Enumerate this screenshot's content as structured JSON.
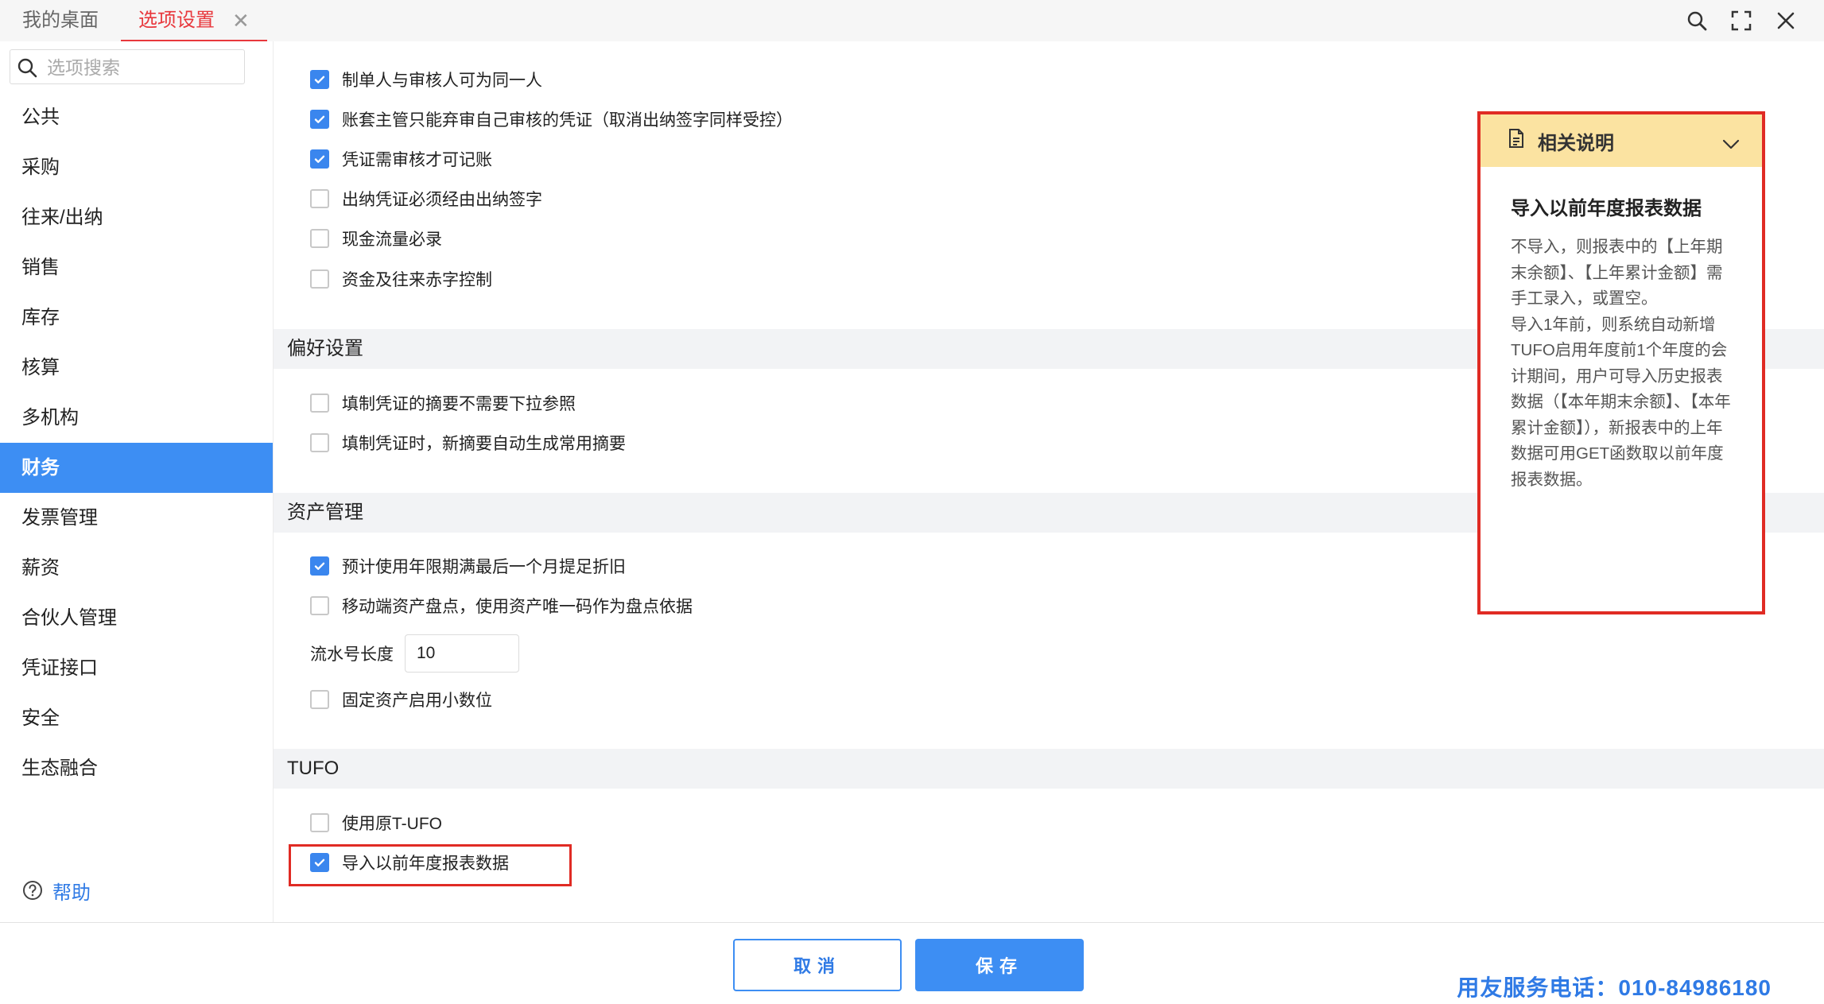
{
  "tabs": {
    "home": "我的桌面",
    "active": "选项设置",
    "close": "✕"
  },
  "toolbar_icons": [
    "search-icon",
    "fullscreen-icon",
    "close-icon"
  ],
  "search": {
    "placeholder": "选项搜索"
  },
  "nav": {
    "items": [
      {
        "label": "公共",
        "active": false
      },
      {
        "label": "采购",
        "active": false
      },
      {
        "label": "往来/出纳",
        "active": false
      },
      {
        "label": "销售",
        "active": false
      },
      {
        "label": "库存",
        "active": false
      },
      {
        "label": "核算",
        "active": false
      },
      {
        "label": "多机构",
        "active": false
      },
      {
        "label": "财务",
        "active": true
      },
      {
        "label": "发票管理",
        "active": false
      },
      {
        "label": "薪资",
        "active": false
      },
      {
        "label": "合伙人管理",
        "active": false
      },
      {
        "label": "凭证接口",
        "active": false
      },
      {
        "label": "安全",
        "active": false
      },
      {
        "label": "生态融合",
        "active": false
      }
    ],
    "help": "帮助"
  },
  "voucher_options": [
    {
      "label": "制单人与审核人可为同一人",
      "checked": true
    },
    {
      "label": "账套主管只能弃审自己审核的凭证（取消出纳签字同样受控）",
      "checked": true
    },
    {
      "label": "凭证需审核才可记账",
      "checked": true
    },
    {
      "label": "出纳凭证必须经由出纳签字",
      "checked": false
    },
    {
      "label": "现金流量必录",
      "checked": false
    },
    {
      "label": "资金及往来赤字控制",
      "checked": false
    }
  ],
  "preference": {
    "title": "偏好设置",
    "options": [
      {
        "label": "填制凭证的摘要不需要下拉参照",
        "checked": false
      },
      {
        "label": "填制凭证时，新摘要自动生成常用摘要",
        "checked": false
      }
    ]
  },
  "assets": {
    "title": "资产管理",
    "options": [
      {
        "label": "预计使用年限期满最后一个月提足折旧",
        "checked": true
      },
      {
        "label": "移动端资产盘点，使用资产唯一码作为盘点依据",
        "checked": false
      }
    ],
    "serial_label": "流水号长度",
    "serial_value": "10",
    "decimal_option": {
      "label": "固定资产启用小数位",
      "checked": false
    }
  },
  "tufo": {
    "title": "TUFO",
    "options": [
      {
        "label": "使用原T-UFO",
        "checked": false
      },
      {
        "label": "导入以前年度报表数据",
        "checked": true
      }
    ]
  },
  "help_panel": {
    "header": "相关说明",
    "title": "导入以前年度报表数据",
    "body": "不导入，则报表中的【上年期末余额】、【上年累计金额】需手工录入，或置空。\n导入1年前，则系统自动新增TUFO启用年度前1个年度的会计期间，用户可导入历史报表数据（【本年期末余额】、【本年累计金额】），新报表中的上年数据可用GET函数取以前年度报表数据。"
  },
  "footer": {
    "cancel": "取消",
    "save": "保存",
    "hotline": "用友服务电话：010-84986180"
  },
  "colors": {
    "accent": "#3d8ef3",
    "active_tab": "#e8383d",
    "highlight_border": "#e02b24",
    "panel_header": "#fbe3a1"
  }
}
